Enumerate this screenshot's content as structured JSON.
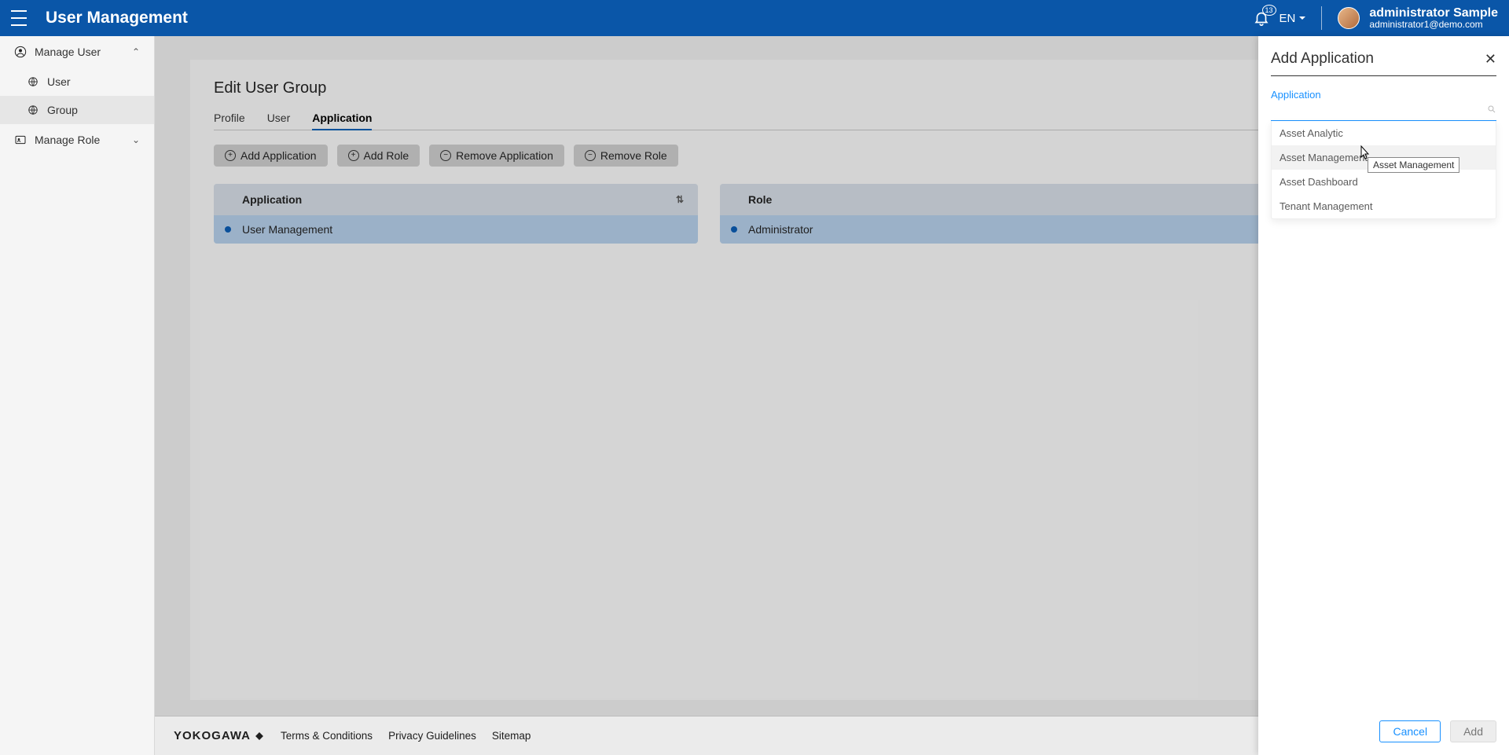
{
  "header": {
    "app_title": "User Management",
    "lang": "EN",
    "notification_count": "13",
    "user_name": "administrator Sample",
    "user_email": "administrator1@demo.com"
  },
  "sidebar": {
    "manage_user": {
      "label": "Manage User",
      "user": "User",
      "group": "Group"
    },
    "manage_role": {
      "label": "Manage Role"
    }
  },
  "page": {
    "title": "Edit User Group",
    "tabs": {
      "profile": "Profile",
      "user": "User",
      "application": "Application"
    }
  },
  "actions": {
    "add_application": "Add Application",
    "add_role": "Add Role",
    "remove_application": "Remove Application",
    "remove_role": "Remove Role"
  },
  "app_table": {
    "header": "Application",
    "row1": "User Management"
  },
  "role_table": {
    "header": "Role",
    "row1": "Administrator"
  },
  "footer": {
    "brand": "YOKOGAWA",
    "terms": "Terms & Conditions",
    "privacy": "Privacy Guidelines",
    "sitemap": "Sitemap"
  },
  "panel": {
    "title": "Add Application",
    "field_label": "Application",
    "tooltip": "Asset Management",
    "options": {
      "opt1": "Asset Analytic",
      "opt2": "Asset Management",
      "opt3": "Asset Dashboard",
      "opt4": "Tenant Management"
    },
    "cancel": "Cancel",
    "add": "Add"
  }
}
